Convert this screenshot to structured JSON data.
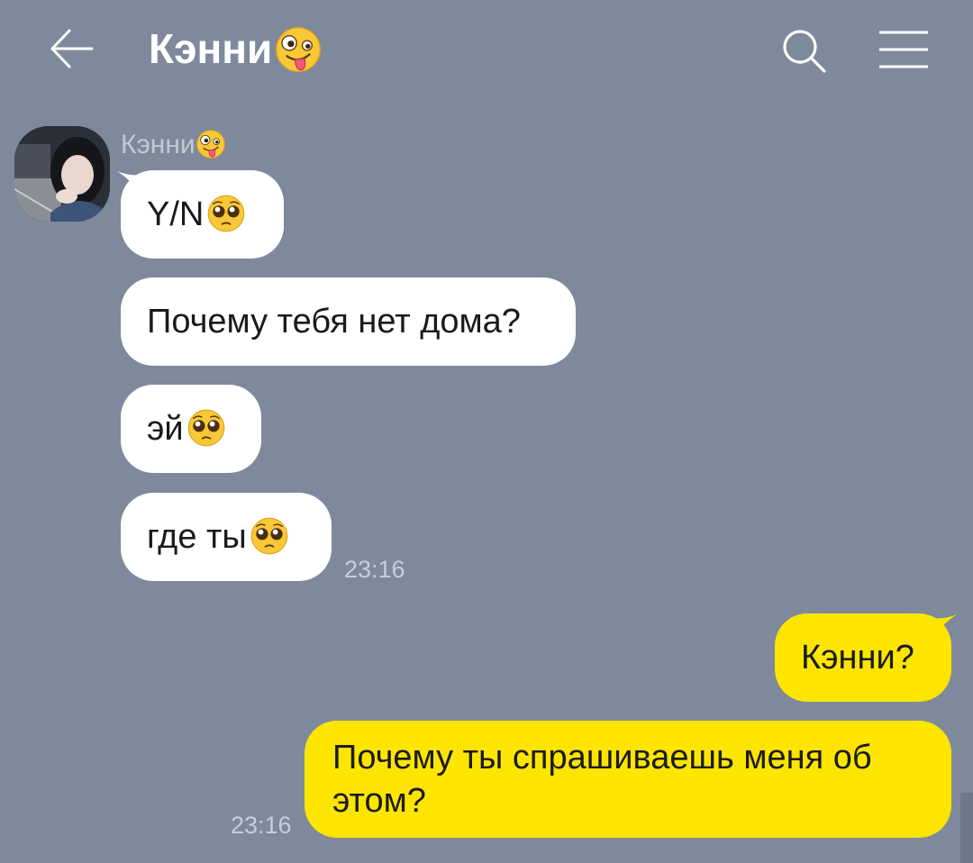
{
  "header": {
    "title": "Кэнни",
    "title_emoji": "zany-face-emoji"
  },
  "icons": {
    "back": "arrow-left-icon",
    "search": "search-icon",
    "menu": "hamburger-menu-icon"
  },
  "colors": {
    "background": "#7f899c",
    "incoming_bubble": "#ffffff",
    "outgoing_bubble": "#fee500",
    "header_text": "#ffffff",
    "timestamp": "#c8ceda"
  },
  "chat": {
    "incoming": {
      "sender": "Кэнни",
      "sender_emoji": "zany-face-emoji",
      "messages": [
        {
          "text": "Y/N",
          "emoji": "pleading-face-emoji"
        },
        {
          "text": "Почему тебя нет дома?"
        },
        {
          "text": "эй",
          "emoji": "pleading-face-emoji"
        },
        {
          "text": "где ты",
          "emoji": "pleading-face-emoji"
        }
      ],
      "time": "23:16"
    },
    "outgoing": {
      "messages": [
        {
          "text": "Кэнни?"
        },
        {
          "line1": "Почему ты спрашиваешь меня об",
          "line2": "этом?"
        }
      ],
      "time": "23:16"
    }
  }
}
